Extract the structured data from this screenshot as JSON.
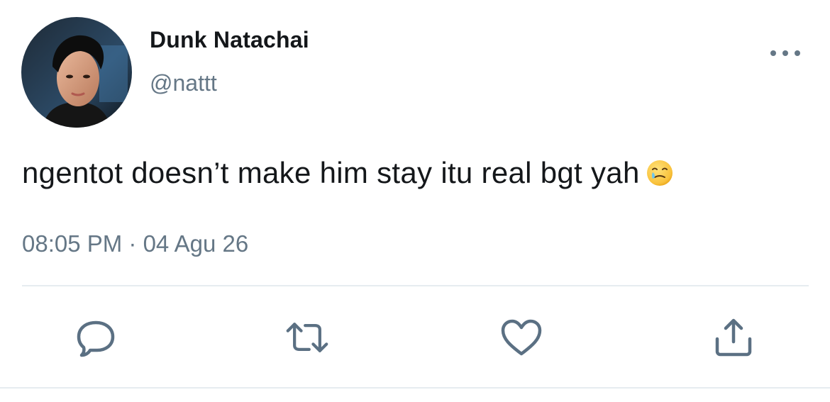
{
  "tweet": {
    "author": {
      "display_name": "Dunk Natachai",
      "handle": "@nattt",
      "avatar_icon": "profile-photo"
    },
    "text": "ngentot doesn’t make him stay itu real bgt yah",
    "emoji": "🥲",
    "timestamp": "08:05 PM · 04 Agu 26"
  },
  "menu": {
    "icon": "more-horizontal-icon"
  },
  "actions": [
    {
      "name": "reply",
      "icon": "reply-icon"
    },
    {
      "name": "retweet",
      "icon": "retweet-icon"
    },
    {
      "name": "like",
      "icon": "heart-icon"
    },
    {
      "name": "share",
      "icon": "share-icon"
    }
  ],
  "colors": {
    "primary_text": "#14171a",
    "secondary_text": "#657786",
    "divider": "#e6ecf0",
    "icon": "#5b7083"
  }
}
